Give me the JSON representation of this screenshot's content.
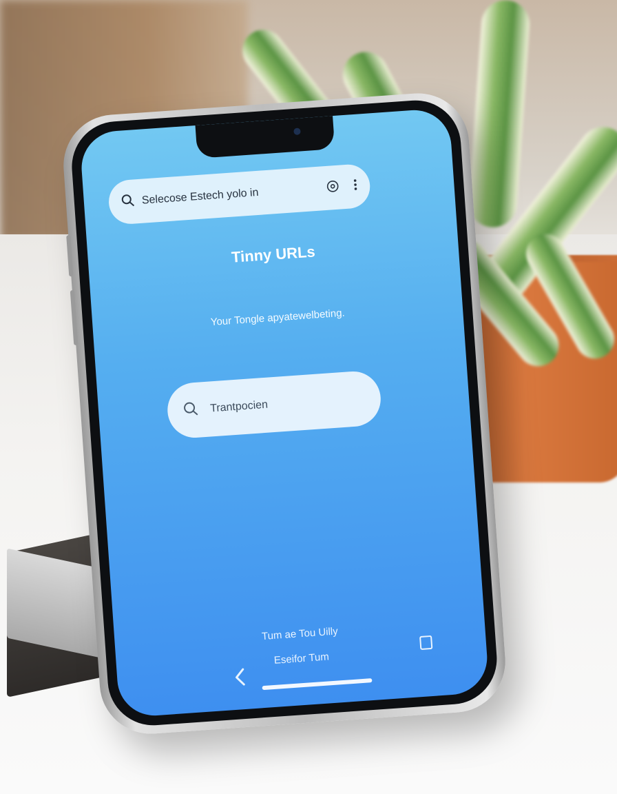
{
  "app": {
    "top_search": {
      "text": "Selecose Estech yolo in"
    },
    "title": "Tinny URLs",
    "subtitle": "Your Tongle apyatewelbeting.",
    "main_search": {
      "text": "Trantpocien"
    },
    "footer": {
      "line1": "Tum ae Tou Uilly",
      "line2": "Eseifor Tum"
    }
  },
  "icons": {
    "top_search": "search-icon",
    "top_info": "info-icon",
    "top_menu": "more-vert-icon",
    "main_search": "search-icon",
    "back": "chevron-left-icon",
    "recents": "square-icon"
  },
  "colors": {
    "screen_top": "#72c8f2",
    "screen_bottom": "#3e8ff0",
    "accent": "#ffffff"
  }
}
